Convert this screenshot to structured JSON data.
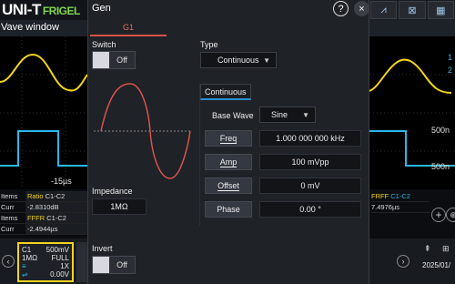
{
  "app": {
    "brand": "UNI-T",
    "brand_sub": "FRIGEL",
    "wave_window_title": "Vave window"
  },
  "scope": {
    "time_label": "-15µs",
    "right_scale_top": "500n",
    "right_scale_bottom": "500n",
    "right_marker_1": "1",
    "right_marker_2": "2",
    "measurements_left": [
      {
        "key": "Items",
        "name": "Ratio",
        "src": "C1-C2",
        "value": ""
      },
      {
        "key": "Curr",
        "name": "",
        "src": "",
        "value": "-2.8310dB"
      },
      {
        "key": "Items",
        "name": "FFFR",
        "src": "C1-C2",
        "value": ""
      },
      {
        "key": "Curr",
        "name": "",
        "src": "",
        "value": "-2.4944µs"
      }
    ],
    "measurement_right": {
      "name": "FRFF",
      "src": "C1-C2",
      "value": "7.4976µs"
    },
    "ch1": {
      "label": "C1",
      "scale": "500mV",
      "impedance": "1MΩ",
      "bw": "FULL",
      "probe": "1X",
      "offset": "0.00V"
    },
    "status_date": "2025/01/",
    "colors": {
      "ch1": "#f3d41d",
      "ch2": "#2ab7e8",
      "gen": "#d9534f",
      "accent": "#2a8fd4"
    }
  },
  "dialog": {
    "title": "Gen",
    "help_icon": "?",
    "close_icon": "×",
    "tab": "G1",
    "switch_label": "Switch",
    "switch_value": "Off",
    "type_label": "Type",
    "type_value": "Continuous",
    "impedance_label": "Impedance",
    "impedance_value": "1MΩ",
    "invert_label": "Invert",
    "invert_value": "Off",
    "subtab": "Continuous",
    "base_wave_label": "Base Wave",
    "base_wave_value": "Sine",
    "params": [
      {
        "label": "Freq",
        "value": "1.000 000 000 kHz"
      },
      {
        "label": "Amp",
        "value": "100 mVpp"
      },
      {
        "label": "Offset",
        "value": "0 mV"
      },
      {
        "label": "Phase",
        "value": "0.00 °"
      }
    ]
  }
}
